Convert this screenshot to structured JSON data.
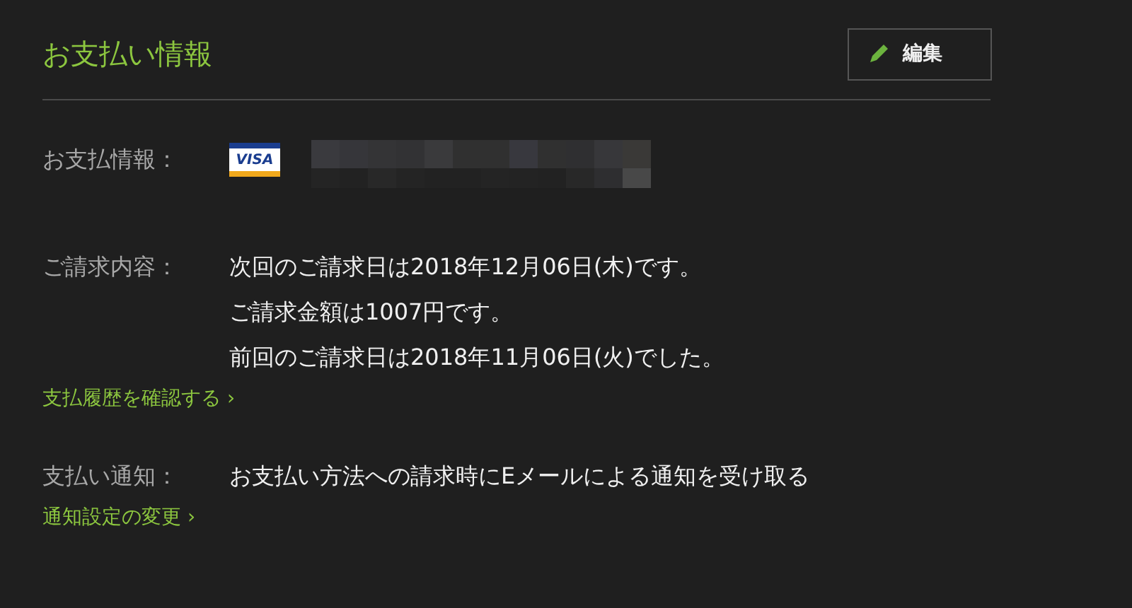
{
  "title": "お支払い情報",
  "edit_button": {
    "label": "編集"
  },
  "payment_info": {
    "label": "お支払情報：",
    "card_brand": "VISA"
  },
  "billing": {
    "label": "ご請求内容：",
    "lines": [
      "次回のご請求日は2018年12月06日(木)です。",
      "ご請求金額は1007円です。",
      "前回のご請求日は2018年11月06日(火)でした。"
    ],
    "link": "支払履歴を確認する ›"
  },
  "notification": {
    "label": "支払い通知：",
    "value": "お支払い方法への請求時にEメールによる通知を受け取る",
    "link": "通知設定の変更 ›"
  }
}
